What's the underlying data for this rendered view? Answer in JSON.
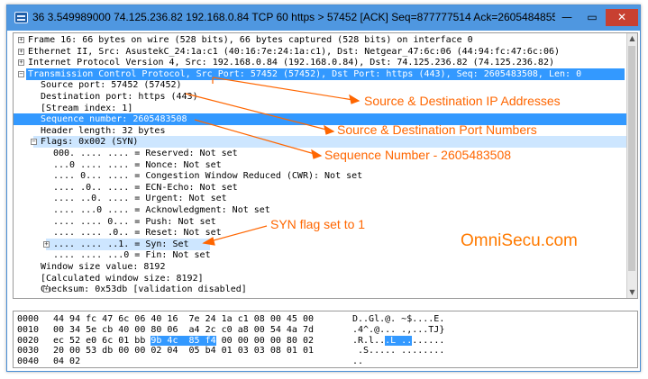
{
  "window": {
    "title": "36 3.549989000 74.125.236.82 192.168.0.84 TCP 60 https > 57452 [ACK] Seq=877777514 Ack=2605484855 Win...",
    "minimize_label": "—",
    "maximize_label": "▭",
    "close_label": "✕"
  },
  "tree": [
    {
      "text": "Frame 16: 66 bytes on wire (528 bits), 66 bytes captured (528 bits) on interface 0",
      "expander": "+"
    },
    {
      "text": "Ethernet II, Src: AsustekC_24:1a:c1 (40:16:7e:24:1a:c1), Dst: Netgear_47:6c:06 (44:94:fc:47:6c:06)",
      "expander": "+"
    },
    {
      "text": "Internet Protocol Version 4, Src: 192.168.0.84 (192.168.0.84), Dst: 74.125.236.82 (74.125.236.82)",
      "expander": "+"
    },
    {
      "text": "Transmission Control Protocol, Src Port: 57452 (57452), Dst Port: https (443), Seq: 2605483508, Len: 0",
      "expander": "−"
    },
    {
      "text": "Source port: 57452 (57452)",
      "expander": ""
    },
    {
      "text": "Destination port: https (443)",
      "expander": ""
    },
    {
      "text": "[Stream index: 1]",
      "expander": ""
    },
    {
      "text": "Sequence number: 2605483508",
      "expander": ""
    },
    {
      "text": "Header length: 32 bytes",
      "expander": ""
    },
    {
      "text": "Flags: 0x002 (SYN)",
      "expander": "−"
    },
    {
      "text": "000. .... .... = Reserved: Not set",
      "expander": ""
    },
    {
      "text": "...0 .... .... = Nonce: Not set",
      "expander": ""
    },
    {
      "text": ".... 0... .... = Congestion Window Reduced (CWR): Not set",
      "expander": ""
    },
    {
      "text": ".... .0.. .... = ECN-Echo: Not set",
      "expander": ""
    },
    {
      "text": ".... ..0. .... = Urgent: Not set",
      "expander": ""
    },
    {
      "text": ".... ...0 .... = Acknowledgment: Not set",
      "expander": ""
    },
    {
      "text": ".... .... 0... = Push: Not set",
      "expander": ""
    },
    {
      "text": ".... .... .0.. = Reset: Not set",
      "expander": ""
    },
    {
      "text": ".... .... ..1. = Syn: Set",
      "expander": "+"
    },
    {
      "text": ".... .... ...0 = Fin: Not set",
      "expander": ""
    },
    {
      "text": "Window size value: 8192",
      "expander": ""
    },
    {
      "text": "[Calculated window size: 8192]",
      "expander": ""
    },
    {
      "text": "Checksum: 0x53db [validation disabled]",
      "expander": "+"
    }
  ],
  "hex_rows": [
    {
      "offset": "0000",
      "pre": "44 94 fc 47 6c 06 40 16  7e 24 1a c1 08 00 45 00",
      "hl": "",
      "post": "",
      "ascii_pre": "D..Gl.@. ~$....E.",
      "ascii_hl": "",
      "ascii_post": ""
    },
    {
      "offset": "0010",
      "pre": "00 34 5e cb 40 00 80 06  a4 2c c0 a8 00 54 4a 7d",
      "hl": "",
      "post": "",
      "ascii_pre": ".4^.@... .,...TJ}",
      "ascii_hl": "",
      "ascii_post": ""
    },
    {
      "offset": "0020",
      "pre": "ec 52 e0 6c 01 bb ",
      "hl": "9b 4c  85 f4",
      "post": " 00 00 00 00 80 02",
      "ascii_pre": ".R.l..",
      "ascii_hl": ".L ..",
      "ascii_post": "......"
    },
    {
      "offset": "0030",
      "pre": "20 00 53 db 00 00 02 04  05 b4 01 03 03 08 01 01",
      "hl": "",
      "post": "",
      "ascii_pre": " .S..... ........",
      "ascii_hl": "",
      "ascii_post": ""
    },
    {
      "offset": "0040",
      "pre": "04 02",
      "hl": "",
      "post": "",
      "ascii_pre": "..",
      "ascii_hl": "",
      "ascii_post": ""
    }
  ],
  "annotations": {
    "ip": "Source & Destination IP Addresses",
    "port": "Source & Destination Port Numbers",
    "seq": "Sequence Number - 2605483508",
    "syn": "SYN flag set to 1",
    "watermark": "OmniSecu.com"
  },
  "colors": {
    "selection": "#3399ff",
    "annotation": "#ff6600",
    "titlebar": "#4f97e0"
  }
}
